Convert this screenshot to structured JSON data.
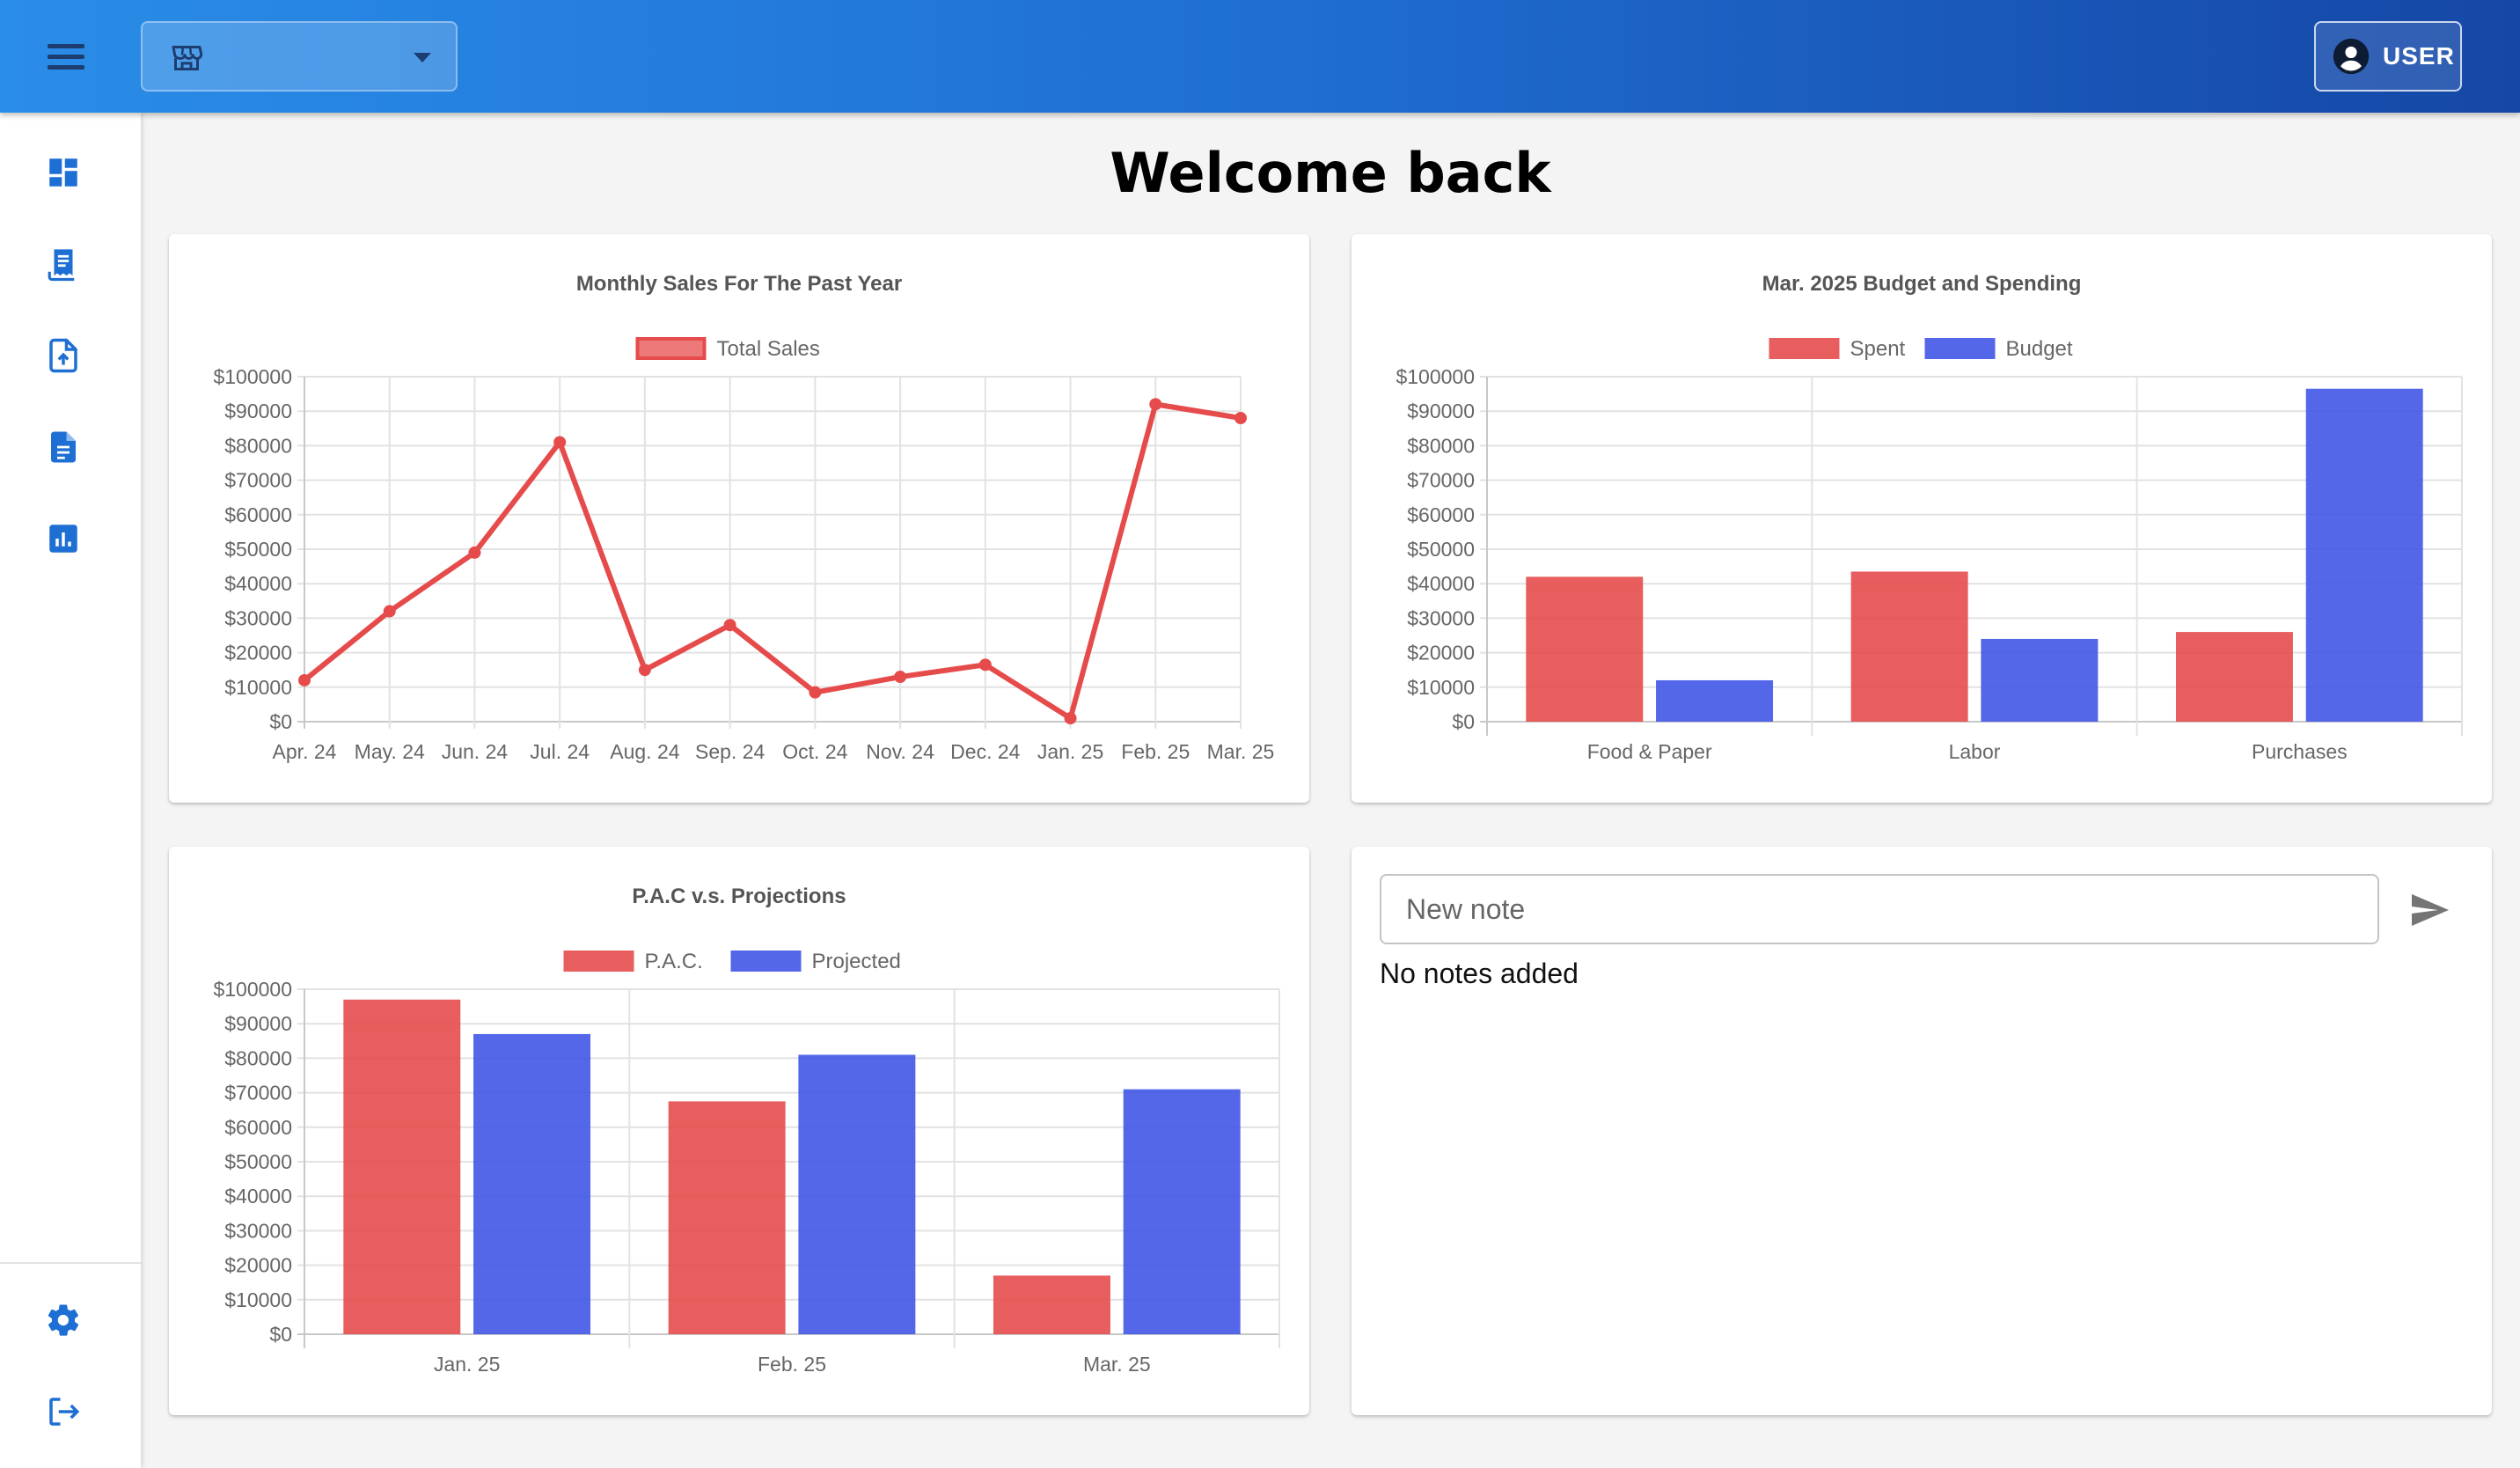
{
  "header": {
    "store_selector_value": "",
    "user_label": "USER"
  },
  "sidebar": {
    "items": [
      {
        "name": "dashboard",
        "icon": "dashboard-icon"
      },
      {
        "name": "receipt",
        "icon": "receipt-icon"
      },
      {
        "name": "upload",
        "icon": "upload-file-icon"
      },
      {
        "name": "document",
        "icon": "document-icon"
      },
      {
        "name": "reports",
        "icon": "analytics-icon"
      }
    ],
    "bottom_items": [
      {
        "name": "settings",
        "icon": "gear-icon"
      },
      {
        "name": "logout",
        "icon": "logout-icon"
      }
    ]
  },
  "main": {
    "title": "Welcome back"
  },
  "notes": {
    "placeholder": "New note",
    "empty_text": "No notes added"
  },
  "colors": {
    "red": "#e64b4b",
    "blue": "#4057e6",
    "accent": "#1e6fd4"
  },
  "chart_data": [
    {
      "type": "line",
      "title": "Monthly Sales For The Past Year",
      "categories": [
        "Apr. 24",
        "May. 24",
        "Jun. 24",
        "Jul. 24",
        "Aug. 24",
        "Sep. 24",
        "Oct. 24",
        "Nov. 24",
        "Dec. 24",
        "Jan. 25",
        "Feb. 25",
        "Mar. 25"
      ],
      "series": [
        {
          "name": "Total Sales",
          "color": "#e64b4b",
          "values": [
            12000,
            32000,
            49000,
            81000,
            15000,
            28000,
            8500,
            13000,
            16500,
            1000,
            92000,
            88000
          ]
        }
      ],
      "ylim": [
        0,
        100000
      ],
      "yticks": [
        "$0",
        "$10000",
        "$20000",
        "$30000",
        "$40000",
        "$50000",
        "$60000",
        "$70000",
        "$80000",
        "$90000",
        "$100000"
      ],
      "grid": true,
      "legend": "top"
    },
    {
      "type": "bar",
      "title": "Mar. 2025 Budget and Spending",
      "categories": [
        "Food & Paper",
        "Labor",
        "Purchases"
      ],
      "series": [
        {
          "name": "Spent",
          "color": "#e64b4b",
          "values": [
            42000,
            43500,
            26000
          ]
        },
        {
          "name": "Budget",
          "color": "#4057e6",
          "values": [
            12000,
            24000,
            96500
          ]
        }
      ],
      "ylim": [
        0,
        100000
      ],
      "yticks": [
        "$0",
        "$10000",
        "$20000",
        "$30000",
        "$40000",
        "$50000",
        "$60000",
        "$70000",
        "$80000",
        "$90000",
        "$100000"
      ],
      "grid": true,
      "legend": "top"
    },
    {
      "type": "bar",
      "title": "P.A.C v.s. Projections",
      "categories": [
        "Jan. 25",
        "Feb. 25",
        "Mar. 25"
      ],
      "series": [
        {
          "name": "P.A.C.",
          "color": "#e64b4b",
          "values": [
            97000,
            67500,
            17000
          ]
        },
        {
          "name": "Projected",
          "color": "#4057e6",
          "values": [
            87000,
            81000,
            71000
          ]
        }
      ],
      "ylim": [
        0,
        100000
      ],
      "yticks": [
        "$0",
        "$10000",
        "$20000",
        "$30000",
        "$40000",
        "$50000",
        "$60000",
        "$70000",
        "$80000",
        "$90000",
        "$100000"
      ],
      "grid": true,
      "legend": "top"
    }
  ]
}
